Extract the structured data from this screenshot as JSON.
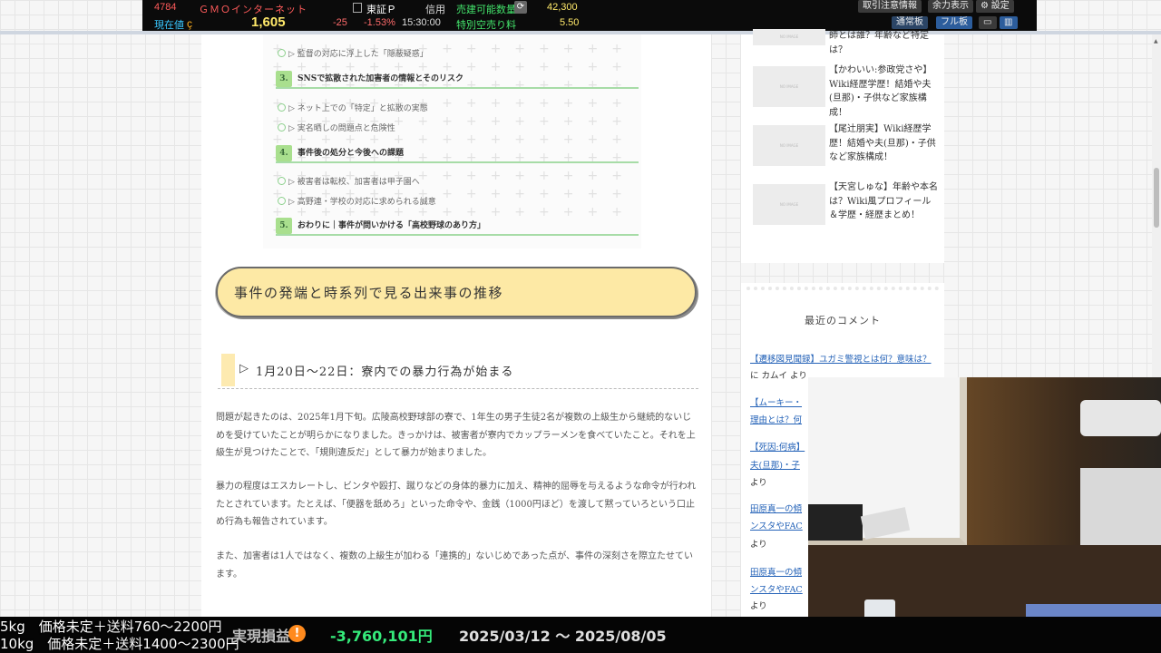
{
  "ticker": {
    "code": "4784",
    "name": "ＧＭＯインターネット",
    "current_label": "現在値",
    "price": "1,605",
    "change": "-25",
    "change_pct": "-1.53%",
    "time": "15:30:00",
    "market": "東証Ｐ",
    "margin": "信用",
    "sell_label": "売建可能数量",
    "sell_qty": "42,300",
    "fee_label": "特別空売り料",
    "fee": "5.50",
    "buttons": {
      "notice": "取引注意情報",
      "power": "余力表示",
      "settings": "設定",
      "normal": "通常板",
      "full": "フル板"
    }
  },
  "toc": {
    "items": [
      {
        "type": "sub",
        "text": "▷ 監督の対応に浮上した「隠蔽疑惑」"
      },
      {
        "type": "sec",
        "num": "3.",
        "text": "SNSで拡散された加害者の情報とそのリスク"
      },
      {
        "type": "sub",
        "text": "▷ ネット上での「特定」と拡散の実態"
      },
      {
        "type": "sub",
        "text": "▷ 実名晒しの問題点と危険性"
      },
      {
        "type": "sec",
        "num": "4.",
        "text": "事件後の処分と今後への課題"
      },
      {
        "type": "sub",
        "text": "▷ 被害者は転校、加害者は甲子園へ"
      },
      {
        "type": "sub",
        "text": "▷ 高野連・学校の対応に求められる誠意"
      },
      {
        "type": "sec",
        "num": "5.",
        "text": "おわりに｜事件が問いかける「高校野球のあり方」"
      }
    ]
  },
  "article": {
    "h2": "事件の発端と時系列で見る出来事の推移",
    "h3_marker": "▷",
    "h3": "1月20日〜22日：寮内での暴力行為が始まる",
    "paragraphs": [
      "問題が起きたのは、2025年1月下旬。広陵高校野球部の寮で、1年生の男子生徒2名が複数の上級生から継続的ないじめを受けていたことが明らかになりました。きっかけは、被害者が寮内でカップラーメンを食べていたこと。それを上級生が見つけたことで、「規則違反だ」として暴力が始まりました。",
      "暴力の程度はエスカレートし、ビンタや殴打、蹴りなどの身体的暴力に加え、精神的屈辱を与えるような命令が行われたとされています。たとえば、「便器を舐めろ」といった命令や、金銭（1000円ほど）を渡して黙っていろという口止め行為も報告されています。",
      "また、加害者は1人ではなく、複数の上級生が加わる「連携的」ないじめであった点が、事件の深刻さを際立たせています。"
    ]
  },
  "sidebar": {
    "thumb_placeholder": "NO IMAGE",
    "related": [
      {
        "title": "師とは誰？年齢など特定は？"
      },
      {
        "title": "【かわいい:参政党さや】Wiki経歴学歴！結婚や夫(旦那)・子供など家族構成！"
      },
      {
        "title": "【尾辻朋実】Wiki経歴学歴！結婚や夫(旦那)・子供など家族構成！"
      },
      {
        "title": "【天宮しゅな】年齢や本名は？Wiki風プロフィール＆学歴・経歴まとめ！"
      }
    ],
    "comments_title": "最近のコメント",
    "comments": [
      {
        "link": "【遷移図見聞録】ユガミ警視とは何？意味は？",
        "by": " に カムイ より"
      },
      {
        "link": "【ムーキー・",
        "by": ""
      },
      {
        "link": "理由とは？何",
        "by": ""
      },
      {
        "link": "【死因:何病】",
        "by": ""
      },
      {
        "link": "夫(旦那)・子",
        "by": ""
      },
      {
        "link": "",
        "by": "より"
      },
      {
        "link": "田原真一の傾",
        "by": ""
      },
      {
        "link": "ンスタやFAC",
        "by": ""
      },
      {
        "link": "",
        "by": "より"
      },
      {
        "link": "田原真一の傾",
        "by": ""
      },
      {
        "link": "ンスタやFAC",
        "by": ""
      },
      {
        "link": "",
        "by": "より"
      }
    ]
  },
  "bottom": {
    "ship1": "5kg　価格未定＋送料760〜2200円",
    "ship2": "10kg　価格未定＋送料1400〜2300円",
    "pl_label": "実現損益",
    "pl_value": "-3,760,101円",
    "pl_range": "2025/03/12 〜 2025/08/05"
  },
  "colors": {
    "accent_green": "#a9df8e",
    "heading_yellow": "#fde9a5",
    "link_blue": "#2563b8",
    "pl_green": "#35ea7a",
    "ticker_red": "#ff5b5b"
  }
}
